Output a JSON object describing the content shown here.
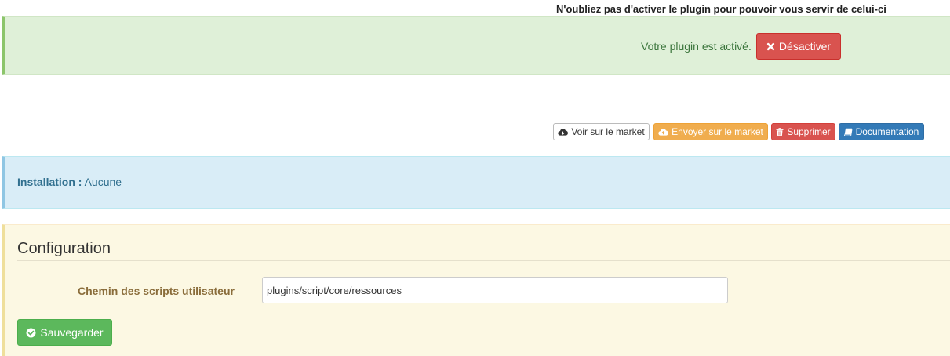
{
  "notice": {
    "text": "N'oubliez pas d'activer le plugin pour pouvoir vous servir de celui-ci"
  },
  "status": {
    "text": "Votre plugin est activé.",
    "deactivate_label": "Désactiver",
    "deactivate_icon": "times-icon"
  },
  "actions": [
    {
      "label": "Voir sur le market",
      "icon": "cloud-download-icon"
    },
    {
      "label": "Envoyer sur le market",
      "icon": "cloud-upload-icon"
    },
    {
      "label": "Supprimer",
      "icon": "trash-icon"
    },
    {
      "label": "Documentation",
      "icon": "book-icon"
    }
  ],
  "installation": {
    "label": "Installation :",
    "value": "Aucune"
  },
  "config": {
    "title": "Configuration",
    "field_label": "Chemin des scripts utilisateur",
    "field_value": "plugins/script/core/ressources",
    "save_label": "Sauvegarder",
    "save_icon": "check-circle-icon"
  },
  "colors": {
    "success_bg": "#dff0d8",
    "info_bg": "#d9edf7",
    "warning_bg": "#fcf8e3",
    "danger": "#d9534f",
    "warning": "#f0ad4e",
    "primary": "#337ab7",
    "success": "#5cb85c"
  }
}
